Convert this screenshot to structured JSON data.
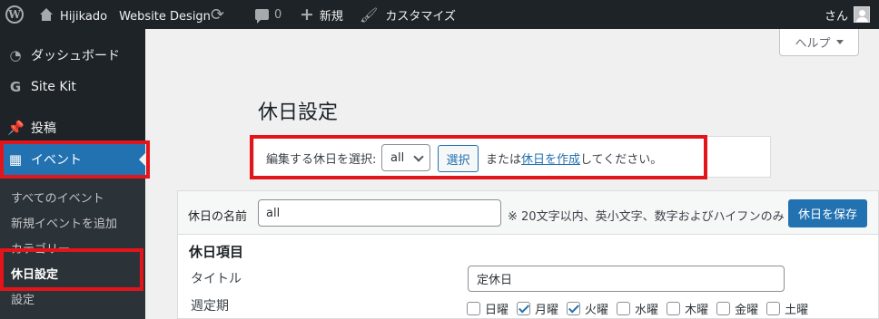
{
  "adminbar": {
    "site_name": "Hijikado　Website Design",
    "comments_count": "0",
    "new_label": "新規",
    "customize_label": "カスタマイズ",
    "account_label": "さん"
  },
  "sidebar": {
    "items": [
      {
        "label": "ダッシュボード",
        "icon": "dashboard-icon"
      },
      {
        "label": "Site Kit",
        "icon": "google-g-icon"
      },
      {
        "label": "投稿",
        "icon": "pin-icon"
      },
      {
        "label": "イベント",
        "icon": "calendar-icon"
      }
    ],
    "submenu": [
      {
        "label": "すべてのイベント"
      },
      {
        "label": "新規イベントを追加"
      },
      {
        "label": "カテゴリー"
      },
      {
        "label": "休日設定"
      },
      {
        "label": "設定"
      }
    ]
  },
  "help": {
    "label": "ヘルプ"
  },
  "page": {
    "title": "休日設定"
  },
  "select_bar": {
    "label": "編集する休日を選択:",
    "selected": "all",
    "button": "選択",
    "or_prefix": "または",
    "create_link": "休日を作成",
    "or_suffix": "してください。"
  },
  "editor": {
    "name_label": "休日の名前",
    "name_value": "all",
    "name_hint": "※ 20文字以内、英小文字、数字およびハイフンのみ",
    "save_button": "休日を保存",
    "section_title": "休日項目",
    "title_label": "タイトル",
    "title_value": "定休日",
    "weekly_label": "週定期",
    "weekdays": [
      {
        "label": "日曜",
        "checked": false
      },
      {
        "label": "月曜",
        "checked": true
      },
      {
        "label": "火曜",
        "checked": true
      },
      {
        "label": "水曜",
        "checked": false
      },
      {
        "label": "木曜",
        "checked": false
      },
      {
        "label": "金曜",
        "checked": false
      },
      {
        "label": "土曜",
        "checked": false
      }
    ]
  },
  "colors": {
    "adminbar_bg": "#1d2327",
    "accent": "#2271b1",
    "highlight": "#e3151a"
  }
}
